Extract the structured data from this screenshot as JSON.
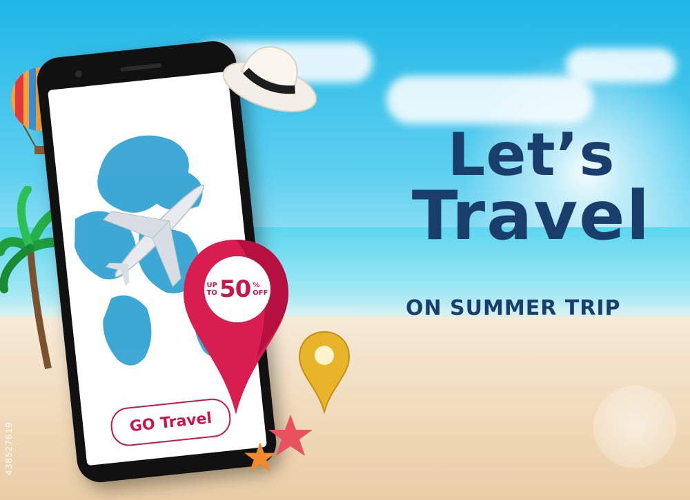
{
  "headline": {
    "line1": "Let’s",
    "line2": "Travel",
    "subtitle": "ON SUMMER TRIP"
  },
  "phone": {
    "button_label": "GO Travel"
  },
  "promo": {
    "prefix_line1": "UP",
    "prefix_line2": "TO",
    "value": "50",
    "suffix_line1": "%",
    "suffix_line2": "OFF"
  },
  "watermark": {
    "stock_id": "438527619"
  },
  "colors": {
    "headline": "#1a3e6c",
    "accent_red": "#c8174a",
    "sky": "#1fb6e6",
    "sand": "#f0d8b6",
    "gold": "#e8b52a"
  },
  "icons": [
    "hot-air-balloon-icon",
    "palm-tree-icon",
    "hat-icon",
    "airplane-icon",
    "world-map-icon",
    "location-pin-icon",
    "gold-pin-icon",
    "starfish-icon"
  ]
}
